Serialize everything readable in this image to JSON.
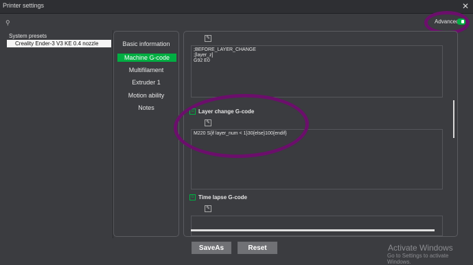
{
  "window": {
    "title": "Printer settings",
    "close": "✕"
  },
  "advanced": {
    "label": "Advanced",
    "enabled": true
  },
  "presets": {
    "label": "System presets",
    "selected": "Creality Ender-3 V3 KE 0.4 nozzle"
  },
  "nav": {
    "items": [
      {
        "label": "Basic information"
      },
      {
        "label": "Machine G-code"
      },
      {
        "label": "Multifilament"
      },
      {
        "label": "Extruder 1"
      },
      {
        "label": "Motion ability"
      },
      {
        "label": "Notes"
      }
    ],
    "active": "Machine G-code"
  },
  "content": {
    "before_layer_lines": [
      ";BEFORE_LAYER_CHANGE",
      ";[layer_z]",
      "G92 E0"
    ],
    "layer_change": {
      "title": "Layer change G-code",
      "code": "M220 S{if layer_num < 1}30{else}100{endif}"
    },
    "time_lapse": {
      "title": "Time lapse G-code"
    }
  },
  "buttons": {
    "save_as": "SaveAs",
    "reset": "Reset"
  },
  "watermark": {
    "line1": "Activate Windows",
    "line2": "Go to Settings to activate Windows."
  },
  "colors": {
    "accent": "#00ae42",
    "annotation": "#6b0f6b",
    "background": "#3b3c40"
  },
  "icons": {
    "search": "search-icon",
    "edit": "edit-icon",
    "gcode": "gcode-section-icon"
  }
}
